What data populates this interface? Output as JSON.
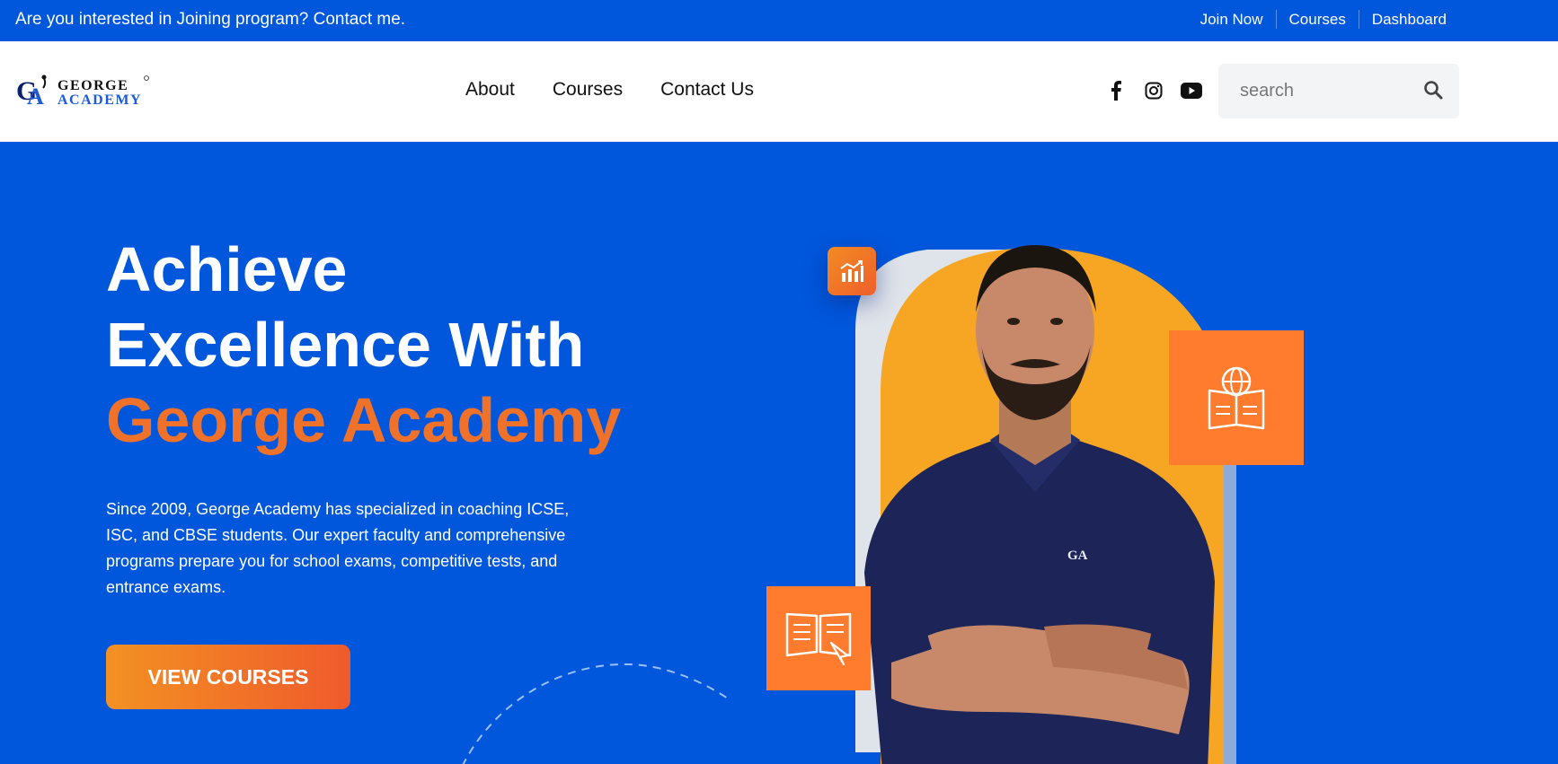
{
  "topbar": {
    "promo": "Are you interested in Joining program? Contact me.",
    "links": [
      "Join Now",
      "Courses",
      "Dashboard"
    ]
  },
  "header": {
    "logo_text": [
      "GEORGE",
      "ACADEMY"
    ],
    "nav": [
      "About",
      "Courses",
      "Contact Us"
    ],
    "social_icons": [
      "facebook-icon",
      "instagram-icon",
      "youtube-icon"
    ],
    "search_placeholder": "search"
  },
  "hero": {
    "headline_line1": "Achieve",
    "headline_line2": "Excellence With",
    "headline_accent": "George Academy",
    "description": "Since 2009, George Academy has specialized in coaching ICSE, ISC, and CBSE students. Our expert faculty and comprehensive programs prepare you for school exams, competitive tests, and entrance exams.",
    "cta_label": "VIEW COURSES"
  },
  "colors": {
    "primary_blue": "#0057dc",
    "accent_orange": "#f0722a",
    "tile_orange": "#ff7c2e",
    "arch_yellow": "#f6a623"
  }
}
